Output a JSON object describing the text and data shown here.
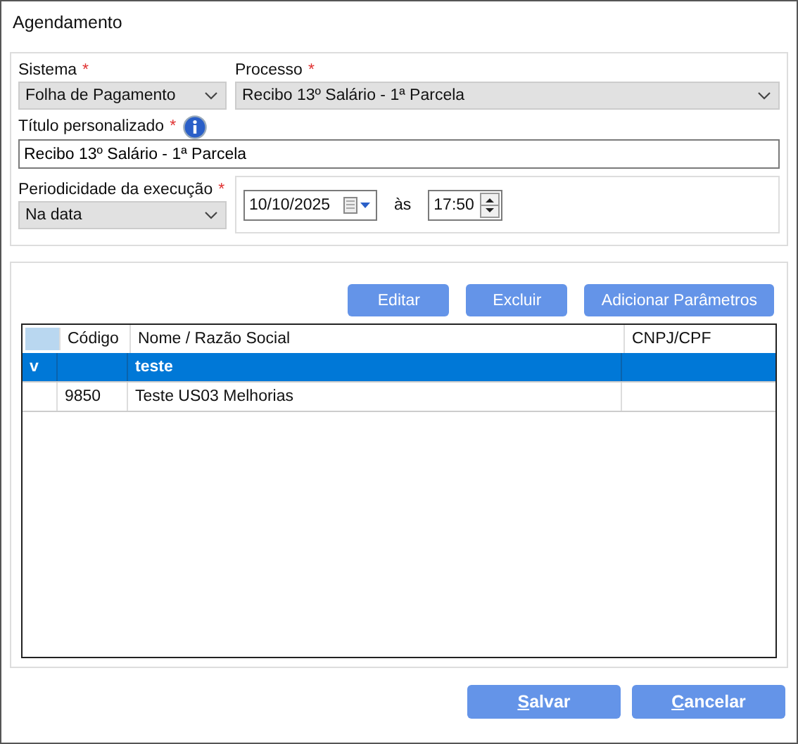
{
  "window": {
    "title": "Agendamento"
  },
  "form": {
    "sistema": {
      "label": "Sistema",
      "required_mark": "*",
      "value": "Folha de Pagamento"
    },
    "processo": {
      "label": "Processo",
      "required_mark": "*",
      "value": "Recibo 13º Salário - 1ª Parcela"
    },
    "titulo": {
      "label": "Título personalizado",
      "required_mark": "*",
      "value": "Recibo 13º Salário - 1ª Parcela"
    },
    "periodicidade": {
      "label": "Periodicidade da execução",
      "required_mark": "*",
      "value": "Na data"
    },
    "date": "10/10/2025",
    "at_label": "às",
    "time": "17:50"
  },
  "toolbar": [
    "Editar",
    "Excluir",
    "Adicionar Parâmetros"
  ],
  "table": {
    "columns": [
      "Código",
      "Nome / Razão Social",
      "CNPJ/CPF"
    ],
    "rows": [
      {
        "indicator": "v",
        "code": "",
        "name": "teste",
        "cnpj": "",
        "selected": true
      },
      {
        "indicator": "",
        "code": "9850",
        "name": "Teste US03 Melhorias",
        "cnpj": "",
        "selected": false
      }
    ]
  },
  "buttons": [
    {
      "label": "Salvar",
      "underline_first": true
    },
    {
      "label": "Cancelar",
      "underline_first": true
    }
  ]
}
